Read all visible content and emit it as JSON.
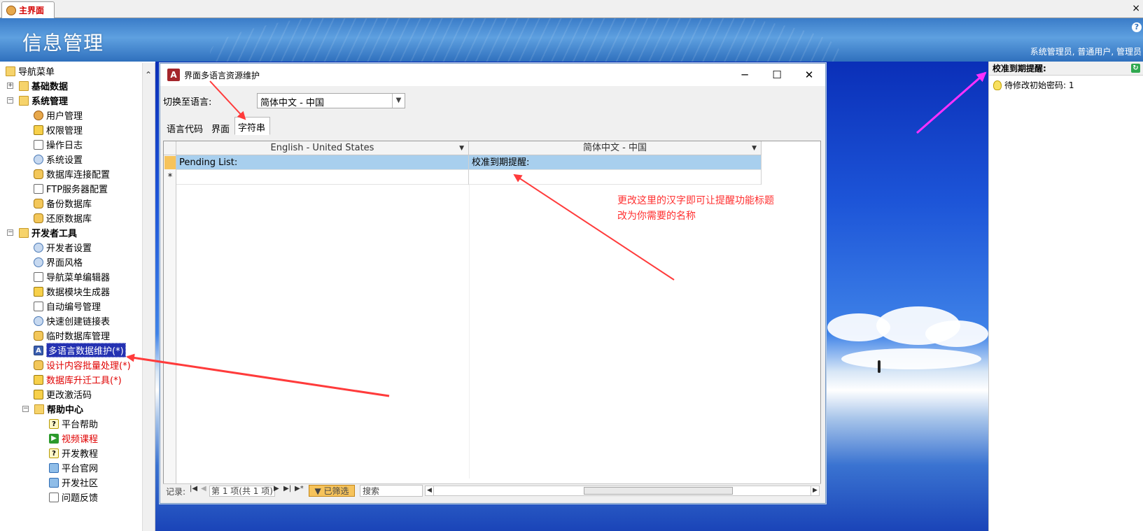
{
  "app_tab": {
    "label": "主界面",
    "close": "×"
  },
  "banner": {
    "title": "信息管理",
    "user": "系统管理员, 普通用户, 管理员",
    "help": "?"
  },
  "nav": {
    "root": "导航菜单",
    "basic_data": "基础数据",
    "system": {
      "label": "系统管理",
      "items": [
        "用户管理",
        "权限管理",
        "操作日志",
        "系统设置",
        "数据库连接配置",
        "FTP服务器配置",
        "备份数据库",
        "还原数据库"
      ]
    },
    "dev": {
      "label": "开发者工具",
      "items": [
        "开发者设置",
        "界面风格",
        "导航菜单编辑器",
        "数据模块生成器",
        "自动编号管理",
        "快速创建链接表",
        "临时数据库管理",
        "多语言数据维护(*)",
        "设计内容批量处理(*)",
        "数据库升迁工具(*)",
        "更改激活码"
      ]
    },
    "help": {
      "label": "帮助中心",
      "items": [
        "平台帮助",
        "视频课程",
        "开发教程",
        "平台官网",
        "开发社区",
        "问题反馈"
      ]
    }
  },
  "pending": {
    "title": "校准到期提醒:",
    "item": "待修改初始密码: 1"
  },
  "dialog": {
    "title": "界面多语言资源维护",
    "min": "─",
    "max": "☐",
    "close": "✕",
    "switch_label": "切换至语言:",
    "switch_value": "简体中文 - 中国",
    "tabs": [
      "语言代码",
      "界面",
      "字符串"
    ],
    "columns": [
      "English - United States",
      "简体中文 - 中国"
    ],
    "rows": [
      [
        "Pending List:",
        "校准到期提醒:"
      ]
    ],
    "new_row_marker": "*",
    "navbar": {
      "record_label": "记录:",
      "position": "第 1 项(共 1 项)",
      "filter": "已筛选",
      "search": "搜索"
    }
  },
  "annotation": {
    "line1": "更改这里的汉字即可让提醒功能标题",
    "line2": "改为你需要的名称"
  },
  "colors": {
    "banner": "#3a7cc8",
    "arrow": "#ff3b3b",
    "arrow2": "#ff30ff",
    "selected_nav": "#2431b2",
    "red_text": "#e00000",
    "grid_row": "#a8cfee"
  }
}
